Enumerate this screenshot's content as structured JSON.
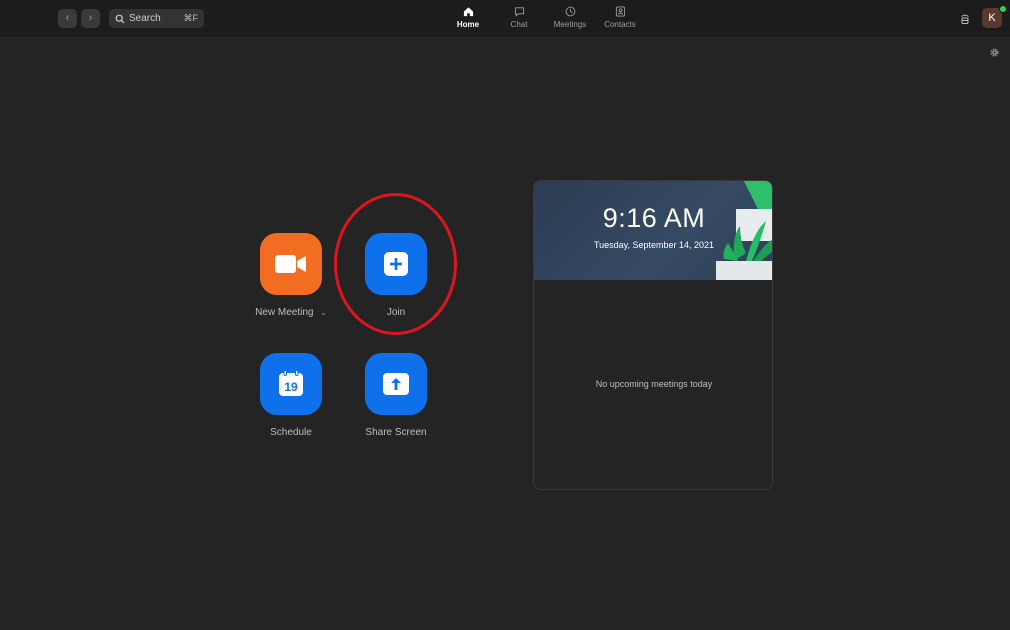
{
  "toolbar": {
    "search_label": "Search",
    "search_shortcut": "⌘F",
    "tabs": [
      {
        "label": "Home",
        "icon": "home-icon",
        "active": true
      },
      {
        "label": "Chat",
        "icon": "chat-icon",
        "active": false
      },
      {
        "label": "Meetings",
        "icon": "clock-icon",
        "active": false
      },
      {
        "label": "Contacts",
        "icon": "contacts-icon",
        "active": false
      }
    ],
    "avatar_initial": "K",
    "status_color": "#2bd25b"
  },
  "actions": {
    "new_meeting": {
      "label": "New Meeting",
      "icon": "video-camera-icon",
      "color": "#f26d21"
    },
    "join": {
      "label": "Join",
      "icon": "plus-icon",
      "color": "#0e71eb"
    },
    "schedule": {
      "label": "Schedule",
      "icon": "calendar-icon",
      "day": "19",
      "color": "#0e71eb"
    },
    "share_screen": {
      "label": "Share Screen",
      "icon": "upload-arrow-icon",
      "color": "#0e71eb"
    }
  },
  "annotation": {
    "color": "#e0141c",
    "target": "join"
  },
  "meetings_panel": {
    "time": "9:16 AM",
    "date": "Tuesday, September 14, 2021",
    "empty_message": "No upcoming meetings today"
  }
}
